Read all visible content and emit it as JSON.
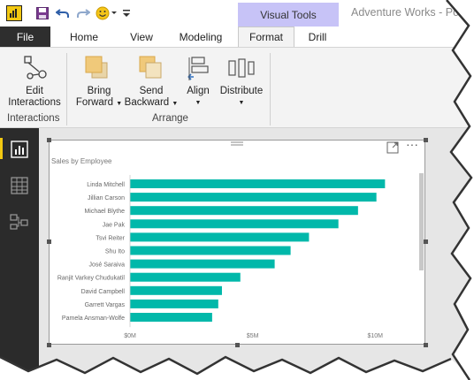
{
  "window": {
    "title": "Adventure Works - Po",
    "context_tab": "Visual Tools"
  },
  "quick_access": {
    "icons": [
      "power-bi-logo-icon",
      "save-icon",
      "undo-icon",
      "redo-icon",
      "smiley-icon",
      "customize-dropdown-icon"
    ]
  },
  "tabs": [
    {
      "label": "File",
      "active": false
    },
    {
      "label": "Home",
      "active": false
    },
    {
      "label": "View",
      "active": false
    },
    {
      "label": "Modeling",
      "active": false
    },
    {
      "label": "Format",
      "active": true
    },
    {
      "label": "Drill",
      "active": false
    }
  ],
  "ribbon": {
    "interactions": {
      "button": {
        "line1": "Edit",
        "line2": "Interactions"
      },
      "group_label": "Interactions"
    },
    "arrange": {
      "bring_forward": {
        "line1": "Bring",
        "line2": "Forward"
      },
      "send_backward": {
        "line1": "Send",
        "line2": "Backward"
      },
      "align": {
        "label": "Align"
      },
      "distribute": {
        "label": "Distribute"
      },
      "group_label": "Arrange"
    }
  },
  "left_nav": [
    {
      "icon": "report-view-icon",
      "active": true
    },
    {
      "icon": "data-view-icon",
      "active": false
    },
    {
      "icon": "relationships-view-icon",
      "active": false
    }
  ],
  "visual": {
    "header_icons": [
      "focus-mode-icon",
      "more-options-icon"
    ]
  },
  "chart_data": {
    "type": "bar",
    "orientation": "horizontal",
    "title": "Sales by Employee",
    "categories": [
      "Linda Mitchell",
      "Jillian Carson",
      "Michael Blythe",
      "Jae Pak",
      "Tsvi Reiter",
      "Shu Ito",
      "José Saraiva",
      "Ranjit Varkey Chudukatil",
      "David Campbell",
      "Garrett Vargas",
      "Pamela Ansman-Wolfe"
    ],
    "values": [
      10.4,
      10.05,
      9.3,
      8.5,
      7.3,
      6.55,
      5.9,
      4.5,
      3.75,
      3.6,
      3.35
    ],
    "xlim": [
      0,
      11
    ],
    "xticks": [
      0,
      5,
      10
    ],
    "xtick_labels": [
      "$0M",
      "$5M",
      "$10M"
    ],
    "bar_color": "#01b8aa",
    "grid": false,
    "legend": "none"
  }
}
